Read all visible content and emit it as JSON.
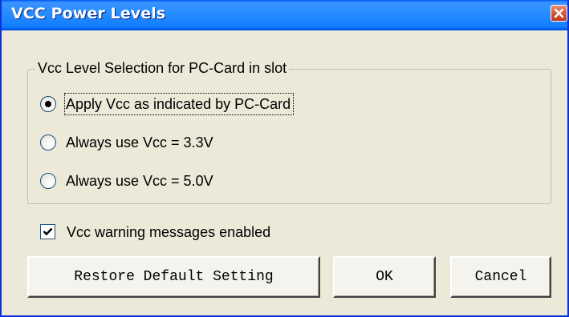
{
  "window": {
    "title": "VCC Power Levels",
    "close_icon": "close-icon"
  },
  "group": {
    "legend": "Vcc Level Selection for PC-Card in slot",
    "options": [
      {
        "label": "Apply Vcc as indicated by PC-Card",
        "checked": true
      },
      {
        "label": "Always use Vcc = 3.3V",
        "checked": false
      },
      {
        "label": "Always use Vcc = 5.0V",
        "checked": false
      }
    ]
  },
  "warnings": {
    "label": "Vcc warning messages enabled",
    "checked": true
  },
  "buttons": {
    "restore": "Restore Default Setting",
    "ok": "OK",
    "cancel": "Cancel"
  },
  "colors": {
    "titlebar": "#0054E3",
    "dialog_background": "#ECE9D8",
    "close_button": "#DA5B3C"
  }
}
